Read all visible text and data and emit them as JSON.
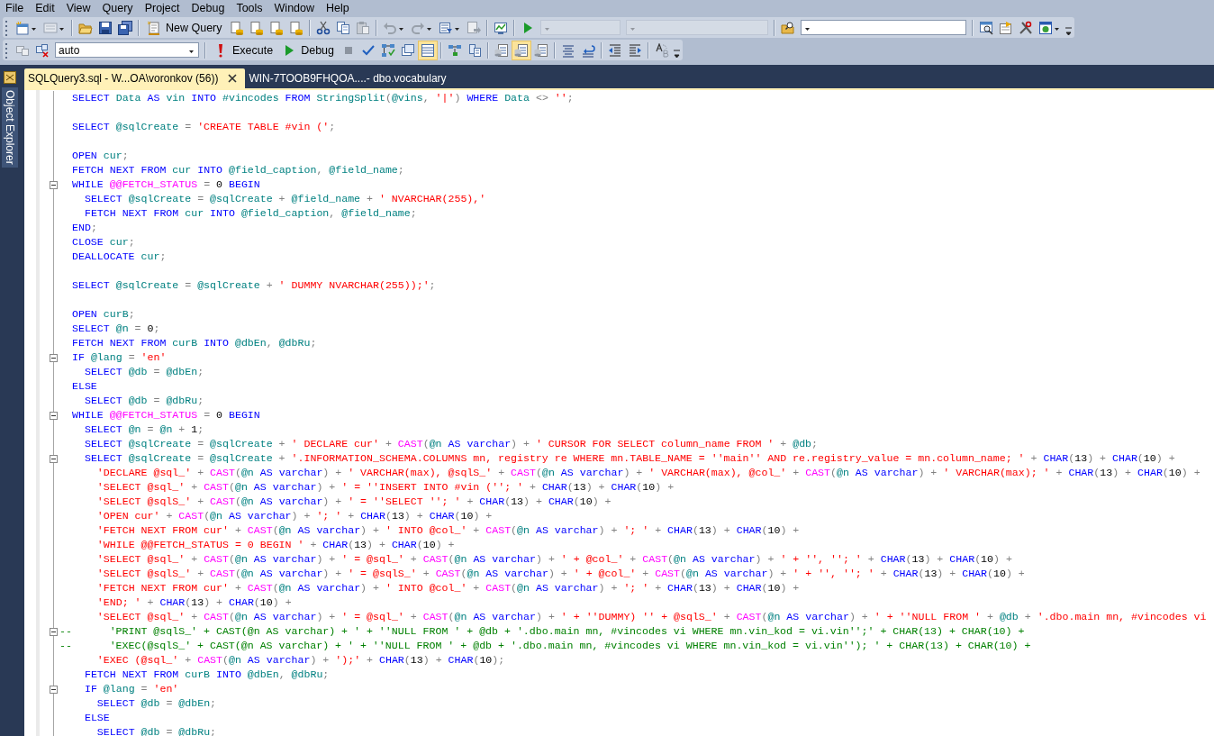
{
  "menu": [
    "File",
    "Edit",
    "View",
    "Query",
    "Project",
    "Debug",
    "Tools",
    "Window",
    "Help"
  ],
  "toolbar1": {
    "new_query": "New Query"
  },
  "toolbar2": {
    "database": "auto",
    "execute": "Execute",
    "debug": "Debug",
    "view_toggles": [
      {
        "selected": false
      },
      {
        "selected": false
      },
      {
        "selected": true
      }
    ],
    "option_toggles": [
      {
        "selected": false
      },
      {
        "selected": true
      },
      {
        "selected": false
      }
    ]
  },
  "sidebar": {
    "title": "Object Explorer"
  },
  "tabs": [
    {
      "label": "SQLQuery3.sql - W...OA\\voronkov (56))",
      "selected": true
    },
    {
      "label": "WIN-7TOOB9FHQOA....- dbo.vocabulary",
      "selected": false
    }
  ],
  "editor": {
    "lines": [
      {
        "foldable": false,
        "segments": [
          {
            "kind": "kw",
            "text": "SELECT "
          },
          {
            "kind": "id",
            "text": "Data "
          },
          {
            "kind": "kw",
            "text": "AS "
          },
          {
            "kind": "id",
            "text": "vin "
          },
          {
            "kind": "kw",
            "text": "INTO "
          },
          {
            "kind": "id",
            "text": "#vincodes "
          },
          {
            "kind": "kw",
            "text": "FROM "
          },
          {
            "kind": "id",
            "text": "StringSplit"
          },
          {
            "kind": "op",
            "text": "("
          },
          {
            "kind": "id",
            "text": "@vins"
          },
          {
            "kind": "op",
            "text": ", "
          },
          {
            "kind": "str",
            "text": "'|'"
          },
          {
            "kind": "op",
            "text": ") "
          },
          {
            "kind": "kw",
            "text": "WHERE "
          },
          {
            "kind": "id",
            "text": "Data "
          },
          {
            "kind": "op",
            "text": "<> "
          },
          {
            "kind": "str",
            "text": "''"
          },
          {
            "kind": "op",
            "text": ";"
          }
        ]
      },
      {
        "foldable": false
      },
      {
        "foldable": false,
        "segments": [
          {
            "kind": "kw",
            "text": "SELECT "
          },
          {
            "kind": "id",
            "text": "@sqlCreate "
          },
          {
            "kind": "op",
            "text": "= "
          },
          {
            "kind": "str",
            "text": "'CREATE TABLE #vin ('"
          },
          {
            "kind": "op",
            "text": ";"
          }
        ]
      },
      {
        "foldable": false
      },
      {
        "foldable": false,
        "segments": [
          {
            "kind": "kw",
            "text": "OPEN "
          },
          {
            "kind": "id",
            "text": "cur"
          },
          {
            "kind": "op",
            "text": ";"
          }
        ]
      },
      {
        "foldable": false,
        "segments": [
          {
            "kind": "kw",
            "text": "FETCH NEXT FROM "
          },
          {
            "kind": "id",
            "text": "cur "
          },
          {
            "kind": "kw",
            "text": "INTO "
          },
          {
            "kind": "id",
            "text": "@field_caption"
          },
          {
            "kind": "op",
            "text": ", "
          },
          {
            "kind": "id",
            "text": "@field_name"
          },
          {
            "kind": "op",
            "text": ";"
          }
        ]
      },
      {
        "foldable": true,
        "segments": [
          {
            "kind": "kw",
            "text": "WHILE "
          },
          {
            "kind": "fn",
            "text": "@@FETCH_STATUS "
          },
          {
            "kind": "op",
            "text": "= "
          },
          {
            "kind": "num",
            "text": "0 "
          },
          {
            "kind": "kw",
            "text": "BEGIN"
          }
        ]
      },
      {
        "foldable": false,
        "segments": [
          {
            "kind": "kw",
            "text": "  SELECT "
          },
          {
            "kind": "id",
            "text": "@sqlCreate "
          },
          {
            "kind": "op",
            "text": "= "
          },
          {
            "kind": "id",
            "text": "@sqlCreate "
          },
          {
            "kind": "op",
            "text": "+ "
          },
          {
            "kind": "id",
            "text": "@field_name "
          },
          {
            "kind": "op",
            "text": "+ "
          },
          {
            "kind": "str",
            "text": "' NVARCHAR(255),'"
          }
        ]
      },
      {
        "foldable": false,
        "segments": [
          {
            "kind": "kw",
            "text": "  FETCH NEXT FROM "
          },
          {
            "kind": "id",
            "text": "cur "
          },
          {
            "kind": "kw",
            "text": "INTO "
          },
          {
            "kind": "id",
            "text": "@field_caption"
          },
          {
            "kind": "op",
            "text": ", "
          },
          {
            "kind": "id",
            "text": "@field_name"
          },
          {
            "kind": "op",
            "text": ";"
          }
        ]
      },
      {
        "foldable": false,
        "segments": [
          {
            "kind": "kw",
            "text": "END"
          },
          {
            "kind": "op",
            "text": ";"
          }
        ]
      },
      {
        "foldable": false,
        "segments": [
          {
            "kind": "kw",
            "text": "CLOSE "
          },
          {
            "kind": "id",
            "text": "cur"
          },
          {
            "kind": "op",
            "text": ";"
          }
        ]
      },
      {
        "foldable": false,
        "segments": [
          {
            "kind": "kw",
            "text": "DEALLOCATE "
          },
          {
            "kind": "id",
            "text": "cur"
          },
          {
            "kind": "op",
            "text": ";"
          }
        ]
      },
      {
        "foldable": false
      },
      {
        "foldable": false,
        "segments": [
          {
            "kind": "kw",
            "text": "SELECT "
          },
          {
            "kind": "id",
            "text": "@sqlCreate "
          },
          {
            "kind": "op",
            "text": "= "
          },
          {
            "kind": "id",
            "text": "@sqlCreate "
          },
          {
            "kind": "op",
            "text": "+ "
          },
          {
            "kind": "str",
            "text": "' DUMMY NVARCHAR(255));'"
          },
          {
            "kind": "op",
            "text": ";"
          }
        ]
      },
      {
        "foldable": false
      },
      {
        "foldable": false,
        "segments": [
          {
            "kind": "kw",
            "text": "OPEN "
          },
          {
            "kind": "id",
            "text": "curB"
          },
          {
            "kind": "op",
            "text": ";"
          }
        ]
      },
      {
        "foldable": false,
        "segments": [
          {
            "kind": "kw",
            "text": "SELECT "
          },
          {
            "kind": "id",
            "text": "@n "
          },
          {
            "kind": "op",
            "text": "= "
          },
          {
            "kind": "num",
            "text": "0"
          },
          {
            "kind": "op",
            "text": ";"
          }
        ]
      },
      {
        "foldable": false,
        "segments": [
          {
            "kind": "kw",
            "text": "FETCH NEXT FROM "
          },
          {
            "kind": "id",
            "text": "curB "
          },
          {
            "kind": "kw",
            "text": "INTO "
          },
          {
            "kind": "id",
            "text": "@dbEn"
          },
          {
            "kind": "op",
            "text": ", "
          },
          {
            "kind": "id",
            "text": "@dbRu"
          },
          {
            "kind": "op",
            "text": ";"
          }
        ]
      },
      {
        "foldable": true,
        "segments": [
          {
            "kind": "kw",
            "text": "IF "
          },
          {
            "kind": "id",
            "text": "@lang "
          },
          {
            "kind": "op",
            "text": "= "
          },
          {
            "kind": "str",
            "text": "'en'"
          }
        ]
      },
      {
        "foldable": false,
        "segments": [
          {
            "kind": "kw",
            "text": "  SELECT "
          },
          {
            "kind": "id",
            "text": "@db "
          },
          {
            "kind": "op",
            "text": "= "
          },
          {
            "kind": "id",
            "text": "@dbEn"
          },
          {
            "kind": "op",
            "text": ";"
          }
        ]
      },
      {
        "foldable": false,
        "segments": [
          {
            "kind": "kw",
            "text": "ELSE"
          }
        ]
      },
      {
        "foldable": false,
        "segments": [
          {
            "kind": "kw",
            "text": "  SELECT "
          },
          {
            "kind": "id",
            "text": "@db "
          },
          {
            "kind": "op",
            "text": "= "
          },
          {
            "kind": "id",
            "text": "@dbRu"
          },
          {
            "kind": "op",
            "text": ";"
          }
        ]
      },
      {
        "foldable": true,
        "segments": [
          {
            "kind": "kw",
            "text": "WHILE "
          },
          {
            "kind": "fn",
            "text": "@@FETCH_STATUS "
          },
          {
            "kind": "op",
            "text": "= "
          },
          {
            "kind": "num",
            "text": "0 "
          },
          {
            "kind": "kw",
            "text": "BEGIN"
          }
        ]
      },
      {
        "foldable": false,
        "segments": [
          {
            "kind": "kw",
            "text": "  SELECT "
          },
          {
            "kind": "id",
            "text": "@n "
          },
          {
            "kind": "op",
            "text": "= "
          },
          {
            "kind": "id",
            "text": "@n "
          },
          {
            "kind": "op",
            "text": "+ "
          },
          {
            "kind": "num",
            "text": "1"
          },
          {
            "kind": "op",
            "text": ";"
          }
        ]
      },
      {
        "foldable": false,
        "segments": [
          {
            "kind": "kw",
            "text": "  SELECT "
          },
          {
            "kind": "id",
            "text": "@sqlCreate "
          },
          {
            "kind": "op",
            "text": "= "
          },
          {
            "kind": "id",
            "text": "@sqlCreate "
          },
          {
            "kind": "op",
            "text": "+ "
          },
          {
            "kind": "str",
            "text": "' DECLARE cur' "
          },
          {
            "kind": "op",
            "text": "+ "
          },
          {
            "kind": "fn",
            "text": "CAST"
          },
          {
            "kind": "op",
            "text": "("
          },
          {
            "kind": "id",
            "text": "@n "
          },
          {
            "kind": "kw",
            "text": "AS varchar"
          },
          {
            "kind": "op",
            "text": ") + "
          },
          {
            "kind": "str",
            "text": "' CURSOR FOR SELECT column_name FROM ' "
          },
          {
            "kind": "op",
            "text": "+ "
          },
          {
            "kind": "id",
            "text": "@db"
          },
          {
            "kind": "op",
            "text": ";"
          }
        ]
      },
      {
        "foldable": true,
        "segments": [
          {
            "kind": "kw",
            "text": "  SELECT "
          },
          {
            "kind": "id",
            "text": "@sqlCreate "
          },
          {
            "kind": "op",
            "text": "= "
          },
          {
            "kind": "id",
            "text": "@sqlCreate "
          },
          {
            "kind": "op",
            "text": "+ "
          },
          {
            "kind": "str",
            "text": "'.INFORMATION_SCHEMA.COLUMNS mn, registry re WHERE mn.TABLE_NAME = ''main'' AND re.registry_value = mn.column_name; ' "
          },
          {
            "kind": "op",
            "text": "+ "
          },
          {
            "kind": "kw",
            "text": "CHAR"
          },
          {
            "kind": "op",
            "text": "("
          },
          {
            "kind": "num",
            "text": "13"
          },
          {
            "kind": "op",
            "text": ") + "
          },
          {
            "kind": "kw",
            "text": "CHAR"
          },
          {
            "kind": "op",
            "text": "("
          },
          {
            "kind": "num",
            "text": "10"
          },
          {
            "kind": "op",
            "text": ") +"
          }
        ]
      },
      {
        "foldable": false,
        "segments": [
          {
            "kind": "str",
            "text": "    'DECLARE @sql_' "
          },
          {
            "kind": "op",
            "text": "+ "
          },
          {
            "kind": "fn",
            "text": "CAST"
          },
          {
            "kind": "op",
            "text": "("
          },
          {
            "kind": "id",
            "text": "@n "
          },
          {
            "kind": "kw",
            "text": "AS varchar"
          },
          {
            "kind": "op",
            "text": ") + "
          },
          {
            "kind": "str",
            "text": "' VARCHAR(max), @sqlS_' "
          },
          {
            "kind": "op",
            "text": "+ "
          },
          {
            "kind": "fn",
            "text": "CAST"
          },
          {
            "kind": "op",
            "text": "("
          },
          {
            "kind": "id",
            "text": "@n "
          },
          {
            "kind": "kw",
            "text": "AS varchar"
          },
          {
            "kind": "op",
            "text": ") + "
          },
          {
            "kind": "str",
            "text": "' VARCHAR(max), @col_' "
          },
          {
            "kind": "op",
            "text": "+ "
          },
          {
            "kind": "fn",
            "text": "CAST"
          },
          {
            "kind": "op",
            "text": "("
          },
          {
            "kind": "id",
            "text": "@n "
          },
          {
            "kind": "kw",
            "text": "AS varchar"
          },
          {
            "kind": "op",
            "text": ") + "
          },
          {
            "kind": "str",
            "text": "' VARCHAR(max); ' "
          },
          {
            "kind": "op",
            "text": "+ "
          },
          {
            "kind": "kw",
            "text": "CHAR"
          },
          {
            "kind": "op",
            "text": "("
          },
          {
            "kind": "num",
            "text": "13"
          },
          {
            "kind": "op",
            "text": ") + "
          },
          {
            "kind": "kw",
            "text": "CHAR"
          },
          {
            "kind": "op",
            "text": "("
          },
          {
            "kind": "num",
            "text": "10"
          },
          {
            "kind": "op",
            "text": ") +"
          }
        ]
      },
      {
        "foldable": false,
        "segments": [
          {
            "kind": "str",
            "text": "    'SELECT @sql_' "
          },
          {
            "kind": "op",
            "text": "+ "
          },
          {
            "kind": "fn",
            "text": "CAST"
          },
          {
            "kind": "op",
            "text": "("
          },
          {
            "kind": "id",
            "text": "@n "
          },
          {
            "kind": "kw",
            "text": "AS varchar"
          },
          {
            "kind": "op",
            "text": ") + "
          },
          {
            "kind": "str",
            "text": "' = ''INSERT INTO #vin (''; ' "
          },
          {
            "kind": "op",
            "text": "+ "
          },
          {
            "kind": "kw",
            "text": "CHAR"
          },
          {
            "kind": "op",
            "text": "("
          },
          {
            "kind": "num",
            "text": "13"
          },
          {
            "kind": "op",
            "text": ") + "
          },
          {
            "kind": "kw",
            "text": "CHAR"
          },
          {
            "kind": "op",
            "text": "("
          },
          {
            "kind": "num",
            "text": "10"
          },
          {
            "kind": "op",
            "text": ") +"
          }
        ]
      },
      {
        "foldable": false,
        "segments": [
          {
            "kind": "str",
            "text": "    'SELECT @sqlS_' "
          },
          {
            "kind": "op",
            "text": "+ "
          },
          {
            "kind": "fn",
            "text": "CAST"
          },
          {
            "kind": "op",
            "text": "("
          },
          {
            "kind": "id",
            "text": "@n "
          },
          {
            "kind": "kw",
            "text": "AS varchar"
          },
          {
            "kind": "op",
            "text": ") + "
          },
          {
            "kind": "str",
            "text": "' = ''SELECT ''; ' "
          },
          {
            "kind": "op",
            "text": "+ "
          },
          {
            "kind": "kw",
            "text": "CHAR"
          },
          {
            "kind": "op",
            "text": "("
          },
          {
            "kind": "num",
            "text": "13"
          },
          {
            "kind": "op",
            "text": ") + "
          },
          {
            "kind": "kw",
            "text": "CHAR"
          },
          {
            "kind": "op",
            "text": "("
          },
          {
            "kind": "num",
            "text": "10"
          },
          {
            "kind": "op",
            "text": ") +"
          }
        ]
      },
      {
        "foldable": false,
        "segments": [
          {
            "kind": "str",
            "text": "    'OPEN cur' "
          },
          {
            "kind": "op",
            "text": "+ "
          },
          {
            "kind": "fn",
            "text": "CAST"
          },
          {
            "kind": "op",
            "text": "("
          },
          {
            "kind": "id",
            "text": "@n "
          },
          {
            "kind": "kw",
            "text": "AS varchar"
          },
          {
            "kind": "op",
            "text": ") + "
          },
          {
            "kind": "str",
            "text": "'; ' "
          },
          {
            "kind": "op",
            "text": "+ "
          },
          {
            "kind": "kw",
            "text": "CHAR"
          },
          {
            "kind": "op",
            "text": "("
          },
          {
            "kind": "num",
            "text": "13"
          },
          {
            "kind": "op",
            "text": ") + "
          },
          {
            "kind": "kw",
            "text": "CHAR"
          },
          {
            "kind": "op",
            "text": "("
          },
          {
            "kind": "num",
            "text": "10"
          },
          {
            "kind": "op",
            "text": ") +"
          }
        ]
      },
      {
        "foldable": false,
        "segments": [
          {
            "kind": "str",
            "text": "    'FETCH NEXT FROM cur' "
          },
          {
            "kind": "op",
            "text": "+ "
          },
          {
            "kind": "fn",
            "text": "CAST"
          },
          {
            "kind": "op",
            "text": "("
          },
          {
            "kind": "id",
            "text": "@n "
          },
          {
            "kind": "kw",
            "text": "AS varchar"
          },
          {
            "kind": "op",
            "text": ") + "
          },
          {
            "kind": "str",
            "text": "' INTO @col_' "
          },
          {
            "kind": "op",
            "text": "+ "
          },
          {
            "kind": "fn",
            "text": "CAST"
          },
          {
            "kind": "op",
            "text": "("
          },
          {
            "kind": "id",
            "text": "@n "
          },
          {
            "kind": "kw",
            "text": "AS varchar"
          },
          {
            "kind": "op",
            "text": ") + "
          },
          {
            "kind": "str",
            "text": "'; ' "
          },
          {
            "kind": "op",
            "text": "+ "
          },
          {
            "kind": "kw",
            "text": "CHAR"
          },
          {
            "kind": "op",
            "text": "("
          },
          {
            "kind": "num",
            "text": "13"
          },
          {
            "kind": "op",
            "text": ") + "
          },
          {
            "kind": "kw",
            "text": "CHAR"
          },
          {
            "kind": "op",
            "text": "("
          },
          {
            "kind": "num",
            "text": "10"
          },
          {
            "kind": "op",
            "text": ") +"
          }
        ]
      },
      {
        "foldable": false,
        "segments": [
          {
            "kind": "str",
            "text": "    'WHILE @@FETCH_STATUS = 0 BEGIN ' "
          },
          {
            "kind": "op",
            "text": "+ "
          },
          {
            "kind": "kw",
            "text": "CHAR"
          },
          {
            "kind": "op",
            "text": "("
          },
          {
            "kind": "num",
            "text": "13"
          },
          {
            "kind": "op",
            "text": ") + "
          },
          {
            "kind": "kw",
            "text": "CHAR"
          },
          {
            "kind": "op",
            "text": "("
          },
          {
            "kind": "num",
            "text": "10"
          },
          {
            "kind": "op",
            "text": ") +"
          }
        ]
      },
      {
        "foldable": false,
        "segments": [
          {
            "kind": "str",
            "text": "    'SELECT @sql_' "
          },
          {
            "kind": "op",
            "text": "+ "
          },
          {
            "kind": "fn",
            "text": "CAST"
          },
          {
            "kind": "op",
            "text": "("
          },
          {
            "kind": "id",
            "text": "@n "
          },
          {
            "kind": "kw",
            "text": "AS varchar"
          },
          {
            "kind": "op",
            "text": ") + "
          },
          {
            "kind": "str",
            "text": "' = @sql_' "
          },
          {
            "kind": "op",
            "text": "+ "
          },
          {
            "kind": "fn",
            "text": "CAST"
          },
          {
            "kind": "op",
            "text": "("
          },
          {
            "kind": "id",
            "text": "@n "
          },
          {
            "kind": "kw",
            "text": "AS varchar"
          },
          {
            "kind": "op",
            "text": ") + "
          },
          {
            "kind": "str",
            "text": "' + @col_' "
          },
          {
            "kind": "op",
            "text": "+ "
          },
          {
            "kind": "fn",
            "text": "CAST"
          },
          {
            "kind": "op",
            "text": "("
          },
          {
            "kind": "id",
            "text": "@n "
          },
          {
            "kind": "kw",
            "text": "AS varchar"
          },
          {
            "kind": "op",
            "text": ") + "
          },
          {
            "kind": "str",
            "text": "' + '', ''; ' "
          },
          {
            "kind": "op",
            "text": "+ "
          },
          {
            "kind": "kw",
            "text": "CHAR"
          },
          {
            "kind": "op",
            "text": "("
          },
          {
            "kind": "num",
            "text": "13"
          },
          {
            "kind": "op",
            "text": ") + "
          },
          {
            "kind": "kw",
            "text": "CHAR"
          },
          {
            "kind": "op",
            "text": "("
          },
          {
            "kind": "num",
            "text": "10"
          },
          {
            "kind": "op",
            "text": ") +"
          }
        ]
      },
      {
        "foldable": false,
        "segments": [
          {
            "kind": "str",
            "text": "    'SELECT @sqlS_' "
          },
          {
            "kind": "op",
            "text": "+ "
          },
          {
            "kind": "fn",
            "text": "CAST"
          },
          {
            "kind": "op",
            "text": "("
          },
          {
            "kind": "id",
            "text": "@n "
          },
          {
            "kind": "kw",
            "text": "AS varchar"
          },
          {
            "kind": "op",
            "text": ") + "
          },
          {
            "kind": "str",
            "text": "' = @sqlS_' "
          },
          {
            "kind": "op",
            "text": "+ "
          },
          {
            "kind": "fn",
            "text": "CAST"
          },
          {
            "kind": "op",
            "text": "("
          },
          {
            "kind": "id",
            "text": "@n "
          },
          {
            "kind": "kw",
            "text": "AS varchar"
          },
          {
            "kind": "op",
            "text": ") + "
          },
          {
            "kind": "str",
            "text": "' + @col_' "
          },
          {
            "kind": "op",
            "text": "+ "
          },
          {
            "kind": "fn",
            "text": "CAST"
          },
          {
            "kind": "op",
            "text": "("
          },
          {
            "kind": "id",
            "text": "@n "
          },
          {
            "kind": "kw",
            "text": "AS varchar"
          },
          {
            "kind": "op",
            "text": ") + "
          },
          {
            "kind": "str",
            "text": "' + '', ''; ' "
          },
          {
            "kind": "op",
            "text": "+ "
          },
          {
            "kind": "kw",
            "text": "CHAR"
          },
          {
            "kind": "op",
            "text": "("
          },
          {
            "kind": "num",
            "text": "13"
          },
          {
            "kind": "op",
            "text": ") + "
          },
          {
            "kind": "kw",
            "text": "CHAR"
          },
          {
            "kind": "op",
            "text": "("
          },
          {
            "kind": "num",
            "text": "10"
          },
          {
            "kind": "op",
            "text": ") +"
          }
        ]
      },
      {
        "foldable": false,
        "segments": [
          {
            "kind": "str",
            "text": "    'FETCH NEXT FROM cur' "
          },
          {
            "kind": "op",
            "text": "+ "
          },
          {
            "kind": "fn",
            "text": "CAST"
          },
          {
            "kind": "op",
            "text": "("
          },
          {
            "kind": "id",
            "text": "@n "
          },
          {
            "kind": "kw",
            "text": "AS varchar"
          },
          {
            "kind": "op",
            "text": ") + "
          },
          {
            "kind": "str",
            "text": "' INTO @col_' "
          },
          {
            "kind": "op",
            "text": "+ "
          },
          {
            "kind": "fn",
            "text": "CAST"
          },
          {
            "kind": "op",
            "text": "("
          },
          {
            "kind": "id",
            "text": "@n "
          },
          {
            "kind": "kw",
            "text": "AS varchar"
          },
          {
            "kind": "op",
            "text": ") + "
          },
          {
            "kind": "str",
            "text": "'; ' "
          },
          {
            "kind": "op",
            "text": "+ "
          },
          {
            "kind": "kw",
            "text": "CHAR"
          },
          {
            "kind": "op",
            "text": "("
          },
          {
            "kind": "num",
            "text": "13"
          },
          {
            "kind": "op",
            "text": ") + "
          },
          {
            "kind": "kw",
            "text": "CHAR"
          },
          {
            "kind": "op",
            "text": "("
          },
          {
            "kind": "num",
            "text": "10"
          },
          {
            "kind": "op",
            "text": ") +"
          }
        ]
      },
      {
        "foldable": false,
        "segments": [
          {
            "kind": "str",
            "text": "    'END; ' "
          },
          {
            "kind": "op",
            "text": "+ "
          },
          {
            "kind": "kw",
            "text": "CHAR"
          },
          {
            "kind": "op",
            "text": "("
          },
          {
            "kind": "num",
            "text": "13"
          },
          {
            "kind": "op",
            "text": ") + "
          },
          {
            "kind": "kw",
            "text": "CHAR"
          },
          {
            "kind": "op",
            "text": "("
          },
          {
            "kind": "num",
            "text": "10"
          },
          {
            "kind": "op",
            "text": ") +"
          }
        ]
      },
      {
        "foldable": false,
        "segments": [
          {
            "kind": "str",
            "text": "    'SELECT @sql_' "
          },
          {
            "kind": "op",
            "text": "+ "
          },
          {
            "kind": "fn",
            "text": "CAST"
          },
          {
            "kind": "op",
            "text": "("
          },
          {
            "kind": "id",
            "text": "@n "
          },
          {
            "kind": "kw",
            "text": "AS varchar"
          },
          {
            "kind": "op",
            "text": ") + "
          },
          {
            "kind": "str",
            "text": "' = @sql_' "
          },
          {
            "kind": "op",
            "text": "+ "
          },
          {
            "kind": "fn",
            "text": "CAST"
          },
          {
            "kind": "op",
            "text": "("
          },
          {
            "kind": "id",
            "text": "@n "
          },
          {
            "kind": "kw",
            "text": "AS varchar"
          },
          {
            "kind": "op",
            "text": ") + "
          },
          {
            "kind": "str",
            "text": "' + ''DUMMY) '' + @sqlS_' "
          },
          {
            "kind": "op",
            "text": "+ "
          },
          {
            "kind": "fn",
            "text": "CAST"
          },
          {
            "kind": "op",
            "text": "("
          },
          {
            "kind": "id",
            "text": "@n "
          },
          {
            "kind": "kw",
            "text": "AS varchar"
          },
          {
            "kind": "op",
            "text": ") + "
          },
          {
            "kind": "str",
            "text": "' + ''NULL FROM ' "
          },
          {
            "kind": "op",
            "text": "+ "
          },
          {
            "kind": "id",
            "text": "@db "
          },
          {
            "kind": "op",
            "text": "+ "
          },
          {
            "kind": "str",
            "text": "'.dbo.main mn, #vincodes vi"
          }
        ]
      },
      {
        "foldable": true,
        "segments": [
          {
            "kind": "cm",
            "text": "--      'PRINT @sqlS_' + CAST(@n AS varchar) + ' + ''NULL FROM ' + @db + '.dbo.main mn, #vincodes vi WHERE mn.vin_kod = vi.vin'';' + CHAR(13) + CHAR(10) +"
          }
        ]
      },
      {
        "foldable": false,
        "segments": [
          {
            "kind": "cm",
            "text": "--      'EXEC(@sqlS_' + CAST(@n AS varchar) + ' + ''NULL FROM ' + @db + '.dbo.main mn, #vincodes vi WHERE mn.vin_kod = vi.vin''); ' + CHAR(13) + CHAR(10) +"
          }
        ]
      },
      {
        "foldable": false,
        "segments": [
          {
            "kind": "str",
            "text": "    'EXEC (@sql_' "
          },
          {
            "kind": "op",
            "text": "+ "
          },
          {
            "kind": "fn",
            "text": "CAST"
          },
          {
            "kind": "op",
            "text": "("
          },
          {
            "kind": "id",
            "text": "@n "
          },
          {
            "kind": "kw",
            "text": "AS varchar"
          },
          {
            "kind": "op",
            "text": ") + "
          },
          {
            "kind": "str",
            "text": "');' "
          },
          {
            "kind": "op",
            "text": "+ "
          },
          {
            "kind": "kw",
            "text": "CHAR"
          },
          {
            "kind": "op",
            "text": "("
          },
          {
            "kind": "num",
            "text": "13"
          },
          {
            "kind": "op",
            "text": ") + "
          },
          {
            "kind": "kw",
            "text": "CHAR"
          },
          {
            "kind": "op",
            "text": "("
          },
          {
            "kind": "num",
            "text": "10"
          },
          {
            "kind": "op",
            "text": ");"
          }
        ]
      },
      {
        "foldable": false,
        "segments": [
          {
            "kind": "kw",
            "text": "  FETCH NEXT FROM "
          },
          {
            "kind": "id",
            "text": "curB "
          },
          {
            "kind": "kw",
            "text": "INTO "
          },
          {
            "kind": "id",
            "text": "@dbEn"
          },
          {
            "kind": "op",
            "text": ", "
          },
          {
            "kind": "id",
            "text": "@dbRu"
          },
          {
            "kind": "op",
            "text": ";"
          }
        ]
      },
      {
        "foldable": true,
        "segments": [
          {
            "kind": "kw",
            "text": "  IF "
          },
          {
            "kind": "id",
            "text": "@lang "
          },
          {
            "kind": "op",
            "text": "= "
          },
          {
            "kind": "str",
            "text": "'en'"
          }
        ]
      },
      {
        "foldable": false,
        "segments": [
          {
            "kind": "kw",
            "text": "    SELECT "
          },
          {
            "kind": "id",
            "text": "@db "
          },
          {
            "kind": "op",
            "text": "= "
          },
          {
            "kind": "id",
            "text": "@dbEn"
          },
          {
            "kind": "op",
            "text": ";"
          }
        ]
      },
      {
        "foldable": false,
        "segments": [
          {
            "kind": "kw",
            "text": "  ELSE"
          }
        ]
      },
      {
        "foldable": false,
        "segments": [
          {
            "kind": "kw",
            "text": "    SELECT "
          },
          {
            "kind": "id",
            "text": "@db "
          },
          {
            "kind": "op",
            "text": "= "
          },
          {
            "kind": "id",
            "text": "@dbRu"
          },
          {
            "kind": "op",
            "text": ";"
          }
        ]
      }
    ]
  }
}
